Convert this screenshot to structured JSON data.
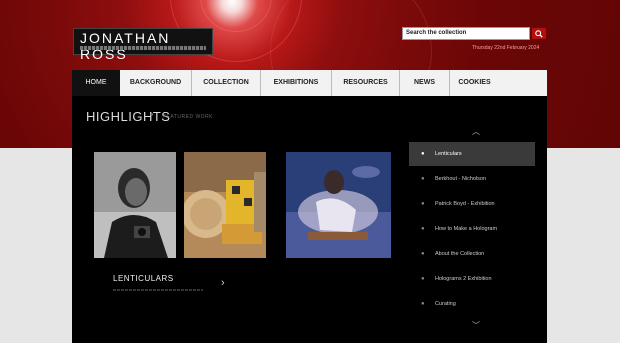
{
  "header": {
    "logo_title": "JONATHAN ROSS",
    "search_placeholder": "Search the collection",
    "search_icon": "search-icon",
    "date": "Thursday 22nd February 2024"
  },
  "nav": {
    "items": [
      "HOME",
      "BACKGROUND",
      "COLLECTION",
      "EXHIBITIONS",
      "RESOURCES",
      "NEWS",
      "COOKIES"
    ],
    "active": "HOME"
  },
  "highlights": {
    "title": "HIGHLIGHTS",
    "subtitle": "FEATURED WORK",
    "caption": "LENTICULARS",
    "next_icon": "chevron-right-icon"
  },
  "sidebar": {
    "up_icon": "chevron-up-icon",
    "down_icon": "chevron-down-icon",
    "items": [
      "Lenticulars",
      "Berkhout - Nicholson",
      "Patrick Boyd - Exhibition",
      "How to Make a Hologram",
      "About the Collection",
      "Holograms 2 Exhibition",
      "Curating"
    ],
    "active_index": 0
  },
  "colors": {
    "header_red": "#8e0e0e",
    "nav_bg": "#f2f2f2",
    "content_bg": "#000000",
    "active_side": "#3a3a3a"
  }
}
